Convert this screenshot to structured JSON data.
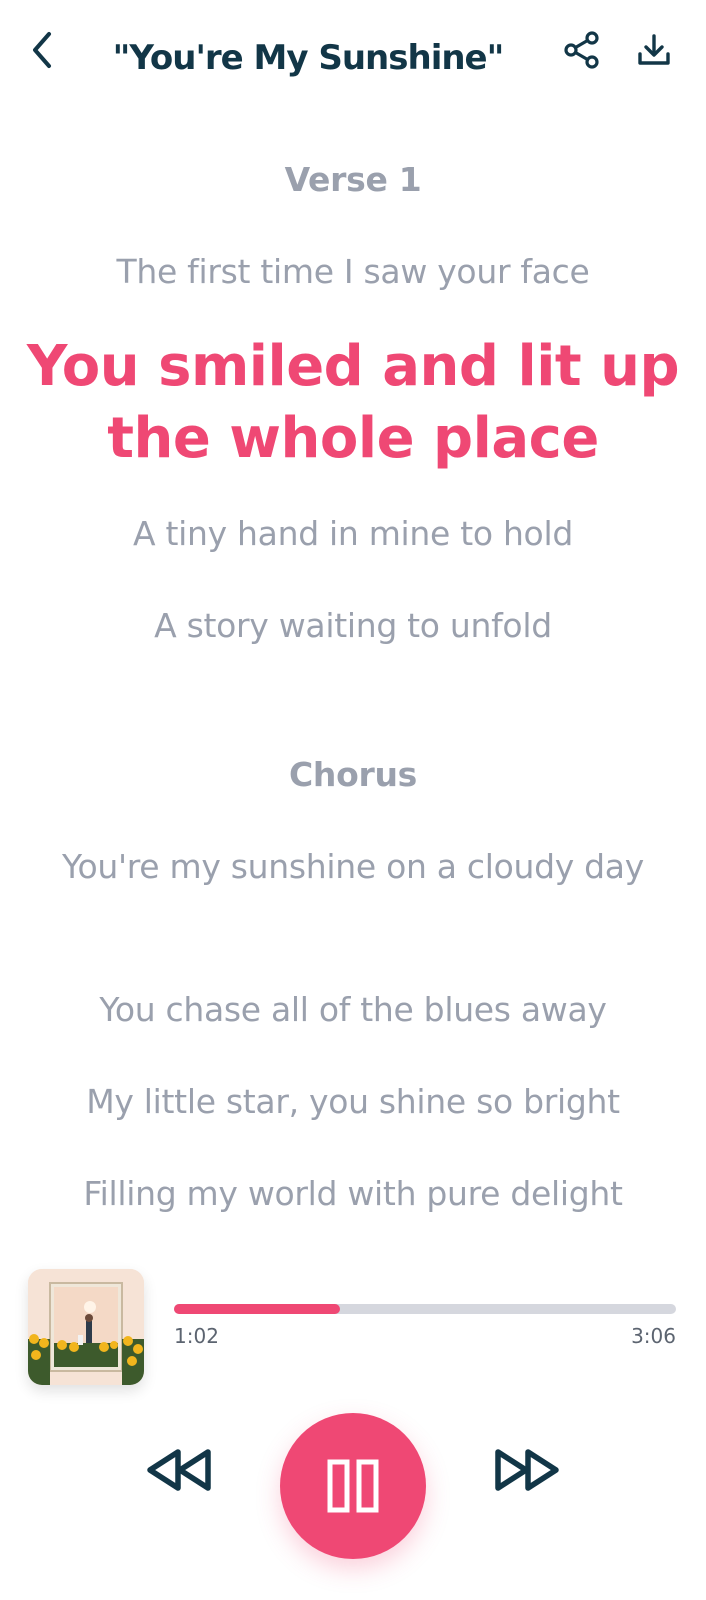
{
  "header": {
    "title": "\"You're My Sunshine\""
  },
  "icons": {
    "back": "chevron-left-icon",
    "share": "share-icon",
    "download": "download-icon",
    "rewind": "rewind-icon",
    "pause": "pause-icon",
    "forward": "fast-forward-icon"
  },
  "lyrics": {
    "lines": [
      {
        "text": "Verse 1",
        "kind": "section"
      },
      {
        "text": "The first time I saw your face",
        "kind": "lyric"
      },
      {
        "text": "You smiled and lit up the whole place",
        "kind": "active"
      },
      {
        "text": "A tiny hand in mine to hold",
        "kind": "lyric"
      },
      {
        "text": "A story waiting to unfold",
        "kind": "lyric"
      },
      {
        "text": "Chorus",
        "kind": "section"
      },
      {
        "text": "You're my sunshine on a cloudy day",
        "kind": "lyric"
      },
      {
        "text": "You chase all of the blues away",
        "kind": "lyric"
      },
      {
        "text": "My little star, you shine so bright",
        "kind": "lyric"
      },
      {
        "text": "Filling my world with pure delight",
        "kind": "lyric"
      }
    ]
  },
  "player": {
    "elapsed": "1:02",
    "total": "3:06",
    "progress": 0.33
  },
  "colors": {
    "accent": "#ef4874",
    "title": "#123647",
    "lyric_inactive": "#9aa0ad",
    "track": "#d5d7de",
    "icon": "#123647"
  }
}
